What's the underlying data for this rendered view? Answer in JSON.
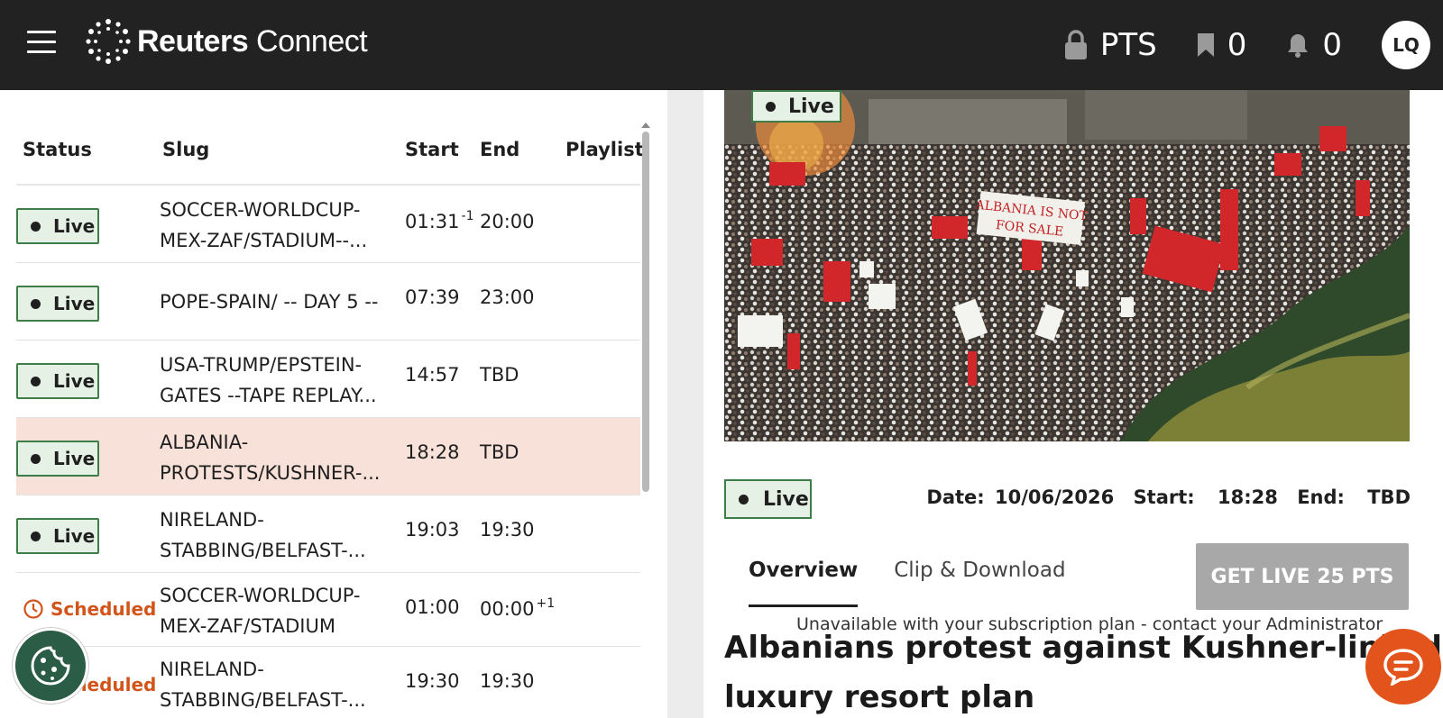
{
  "header": {
    "brand_bold": "Reuters",
    "brand_light": " Connect",
    "pts_label": "PTS",
    "bookmarks_count": "0",
    "notifications_count": "0",
    "avatar_initials": "LQ"
  },
  "table": {
    "columns": {
      "status": "Status",
      "slug": "Slug",
      "start": "Start",
      "end": "End",
      "playlist": "Playlist"
    },
    "rows": [
      {
        "status": "Live",
        "slug_line1": "SOCCER-WORLDCUP-",
        "slug_line2": "MEX-ZAF/STADIUM--...",
        "start": "01:31",
        "start_sup": "-1",
        "end": "20:00",
        "end_sup": ""
      },
      {
        "status": "Live",
        "slug_line1": "POPE-SPAIN/ -- DAY 5 --",
        "slug_line2": "",
        "start": "07:39",
        "start_sup": "",
        "end": "23:00",
        "end_sup": ""
      },
      {
        "status": "Live",
        "slug_line1": "USA-TRUMP/EPSTEIN-",
        "slug_line2": "GATES --TAPE REPLAY...",
        "start": "14:57",
        "start_sup": "",
        "end": "TBD",
        "end_sup": ""
      },
      {
        "status": "Live",
        "slug_line1": "ALBANIA-",
        "slug_line2": "PROTESTS/KUSHNER-...",
        "start": "18:28",
        "start_sup": "",
        "end": "TBD",
        "end_sup": ""
      },
      {
        "status": "Live",
        "slug_line1": "NIRELAND-",
        "slug_line2": "STABBING/BELFAST-...",
        "start": "19:03",
        "start_sup": "",
        "end": "19:30",
        "end_sup": ""
      },
      {
        "status": "Scheduled",
        "slug_line1": "SOCCER-WORLDCUP-",
        "slug_line2": "MEX-ZAF/STADIUM",
        "start": "01:00",
        "start_sup": "",
        "end": "00:00",
        "end_sup": "+1"
      },
      {
        "status": "Scheduled",
        "slug_line1": "NIRELAND-",
        "slug_line2": "STABBING/BELFAST-...",
        "start": "19:30",
        "start_sup": "",
        "end": "19:30",
        "end_sup": ""
      }
    ]
  },
  "detail": {
    "video_badge": "Live",
    "status_badge": "Live",
    "date_label": "Date:",
    "date_value": "10/06/2026",
    "start_label": "Start:",
    "start_value": "18:28",
    "end_label": "End:",
    "end_value": "TBD",
    "tabs": [
      "Overview",
      "Clip & Download"
    ],
    "get_live_label": "GET LIVE 25 PTS",
    "unavailable_note": "Unavailable with your subscription plan - contact your Administrator",
    "headline_line1": "Albanians protest against Kushner-linked",
    "headline_line2": "luxury resort plan",
    "banner_text": "ALBANIA IS NOT FOR SALE"
  },
  "colors": {
    "topbar": "#222222",
    "live_border": "#3e7d47",
    "live_bg": "#e5f1e4",
    "scheduled": "#d1551a",
    "selected_row": "#f8e1d9",
    "chat": "#e2541b",
    "cookie": "#2b5d46"
  },
  "icons": [
    "menu-icon",
    "reuters-logo-icon",
    "lock-icon",
    "bookmark-icon",
    "bell-icon",
    "clock-icon",
    "cookie-icon",
    "chat-icon"
  ]
}
